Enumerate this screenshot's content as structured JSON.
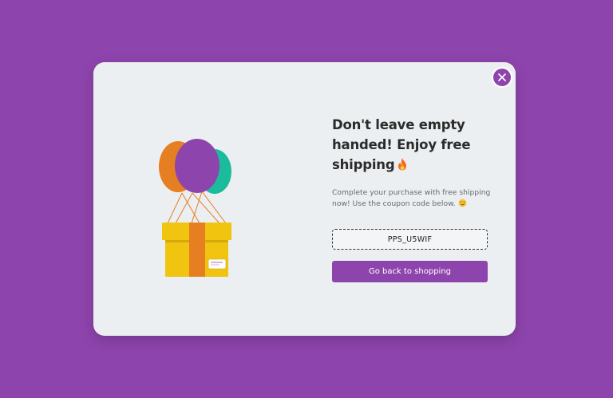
{
  "modal": {
    "headline": "Don't leave empty handed! Enjoy free shipping",
    "body": "Complete your purchase with free shipping now! Use the coupon code below.",
    "coupon_code": "PPS_U5WIF",
    "cta_label": "Go back to shopping",
    "close_icon": "close-icon",
    "headline_emoji": "fire-icon",
    "body_emoji": "wink-emoji-icon",
    "illustration": "balloon-gift-box-illustration"
  },
  "colors": {
    "background": "#8e44ad",
    "modal_background": "#eceff1",
    "accent": "#8e44ad",
    "headline_text": "#2b2b2b",
    "body_text": "#666a6e",
    "balloon_orange": "#e67e22",
    "balloon_teal": "#1abc9c",
    "balloon_purple": "#8e44ad",
    "box_yellow": "#f1c40f"
  }
}
